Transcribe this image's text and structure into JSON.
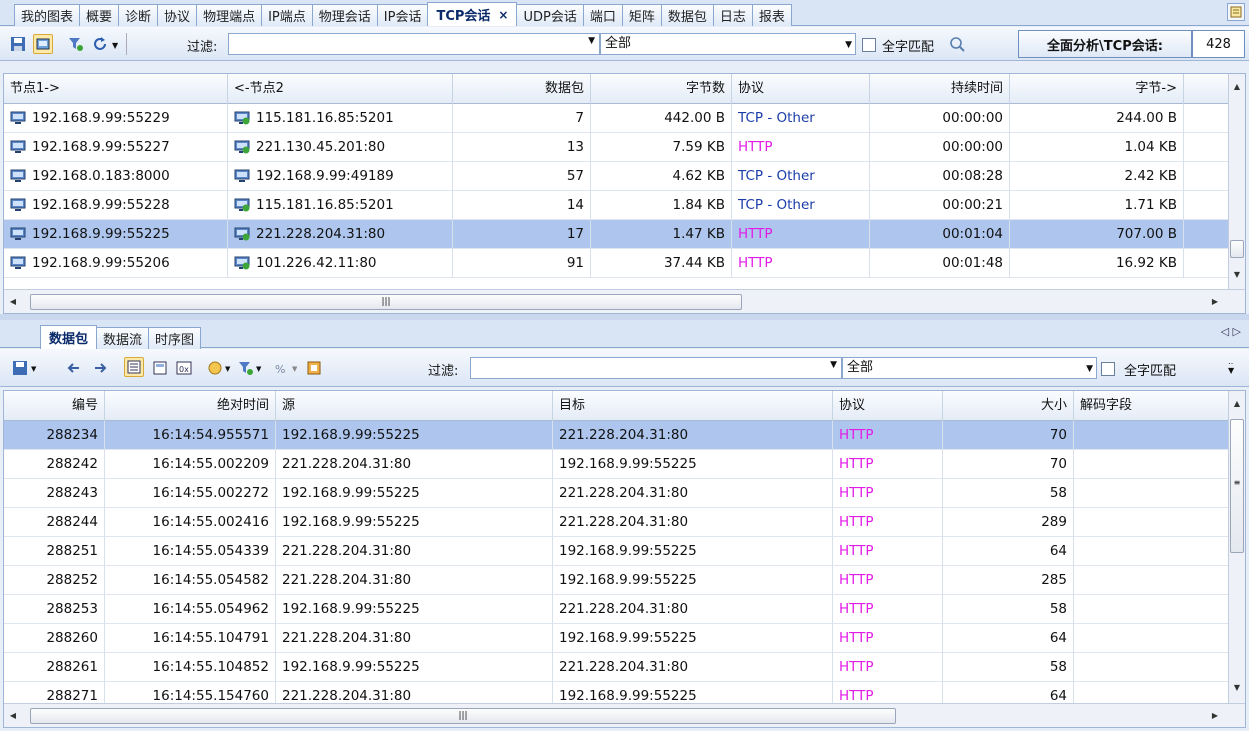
{
  "top_tabs": [
    {
      "label": "我的图表"
    },
    {
      "label": "概要"
    },
    {
      "label": "诊断"
    },
    {
      "label": "协议"
    },
    {
      "label": "物理端点"
    },
    {
      "label": "IP端点"
    },
    {
      "label": "物理会话"
    },
    {
      "label": "IP会话"
    },
    {
      "label": "TCP会话",
      "active": true
    },
    {
      "label": "UDP会话"
    },
    {
      "label": "端口"
    },
    {
      "label": "矩阵"
    },
    {
      "label": "数据包"
    },
    {
      "label": "日志"
    },
    {
      "label": "报表"
    }
  ],
  "close_glyph": "×",
  "toolbar1": {
    "filter_label": "过滤:",
    "filter_value": "",
    "scope_value": "全部",
    "match_label": "全字匹配",
    "path_label": "全面分析\\TCP会话:",
    "count": "428"
  },
  "conv_table": {
    "columns": [
      "节点1->",
      "<-节点2",
      "数据包",
      "字节数",
      "协议",
      "持续时间",
      "字节->"
    ],
    "rows": [
      {
        "node1": "192.168.9.99:55229",
        "node2": "115.181.16.85:5201",
        "packets": "7",
        "bytes": "442.00 B",
        "protocol": "TCP - Other",
        "duration": "00:00:00",
        "bytes_out": "244.00 B"
      },
      {
        "node1": "192.168.9.99:55227",
        "node2": "221.130.45.201:80",
        "packets": "13",
        "bytes": "7.59 KB",
        "protocol": "HTTP",
        "duration": "00:00:00",
        "bytes_out": "1.04 KB"
      },
      {
        "node1": "192.168.0.183:8000",
        "node2": "192.168.9.99:49189",
        "packets": "57",
        "bytes": "4.62 KB",
        "protocol": "TCP - Other",
        "duration": "00:08:28",
        "bytes_out": "2.42 KB"
      },
      {
        "node1": "192.168.9.99:55228",
        "node2": "115.181.16.85:5201",
        "packets": "14",
        "bytes": "1.84 KB",
        "protocol": "TCP - Other",
        "duration": "00:00:21",
        "bytes_out": "1.71 KB"
      },
      {
        "node1": "192.168.9.99:55225",
        "node2": "221.228.204.31:80",
        "packets": "17",
        "bytes": "1.47 KB",
        "protocol": "HTTP",
        "duration": "00:01:04",
        "bytes_out": "707.00 B",
        "selected": true
      },
      {
        "node1": "192.168.9.99:55206",
        "node2": "101.226.42.11:80",
        "packets": "91",
        "bytes": "37.44 KB",
        "protocol": "HTTP",
        "duration": "00:01:48",
        "bytes_out": "16.92 KB"
      }
    ]
  },
  "bottom_tabs": [
    {
      "label": "数据包",
      "active": true
    },
    {
      "label": "数据流"
    },
    {
      "label": "时序图"
    }
  ],
  "nav_glyphs": "◁ ▷",
  "toolbar2": {
    "filter_label": "过滤:",
    "filter_value": "",
    "scope_value": "全部",
    "match_label": "全字匹配"
  },
  "packet_table": {
    "columns": [
      "编号",
      "绝对时间",
      "源",
      "目标",
      "协议",
      "大小",
      "解码字段"
    ],
    "rows": [
      {
        "id": "288234",
        "time": "16:14:54.955571",
        "src": "192.168.9.99:55225",
        "dst": "221.228.204.31:80",
        "protocol": "HTTP",
        "size": "70",
        "selected": true
      },
      {
        "id": "288242",
        "time": "16:14:55.002209",
        "src": "221.228.204.31:80",
        "dst": "192.168.9.99:55225",
        "protocol": "HTTP",
        "size": "70"
      },
      {
        "id": "288243",
        "time": "16:14:55.002272",
        "src": "192.168.9.99:55225",
        "dst": "221.228.204.31:80",
        "protocol": "HTTP",
        "size": "58"
      },
      {
        "id": "288244",
        "time": "16:14:55.002416",
        "src": "192.168.9.99:55225",
        "dst": "221.228.204.31:80",
        "protocol": "HTTP",
        "size": "289"
      },
      {
        "id": "288251",
        "time": "16:14:55.054339",
        "src": "221.228.204.31:80",
        "dst": "192.168.9.99:55225",
        "protocol": "HTTP",
        "size": "64"
      },
      {
        "id": "288252",
        "time": "16:14:55.054582",
        "src": "221.228.204.31:80",
        "dst": "192.168.9.99:55225",
        "protocol": "HTTP",
        "size": "285"
      },
      {
        "id": "288253",
        "time": "16:14:55.054962",
        "src": "192.168.9.99:55225",
        "dst": "221.228.204.31:80",
        "protocol": "HTTP",
        "size": "58"
      },
      {
        "id": "288260",
        "time": "16:14:55.104791",
        "src": "221.228.204.31:80",
        "dst": "192.168.9.99:55225",
        "protocol": "HTTP",
        "size": "64"
      },
      {
        "id": "288261",
        "time": "16:14:55.104852",
        "src": "192.168.9.99:55225",
        "dst": "221.228.204.31:80",
        "protocol": "HTTP",
        "size": "58"
      },
      {
        "id": "288271",
        "time": "16:14:55.154760",
        "src": "221.228.204.31:80",
        "dst": "192.168.9.99:55225",
        "protocol": "HTTP",
        "size": "64"
      }
    ]
  },
  "colors": {
    "http": "#e21ce6",
    "tcp_other": "#1a3ca8",
    "selection": "#aec6ee"
  }
}
